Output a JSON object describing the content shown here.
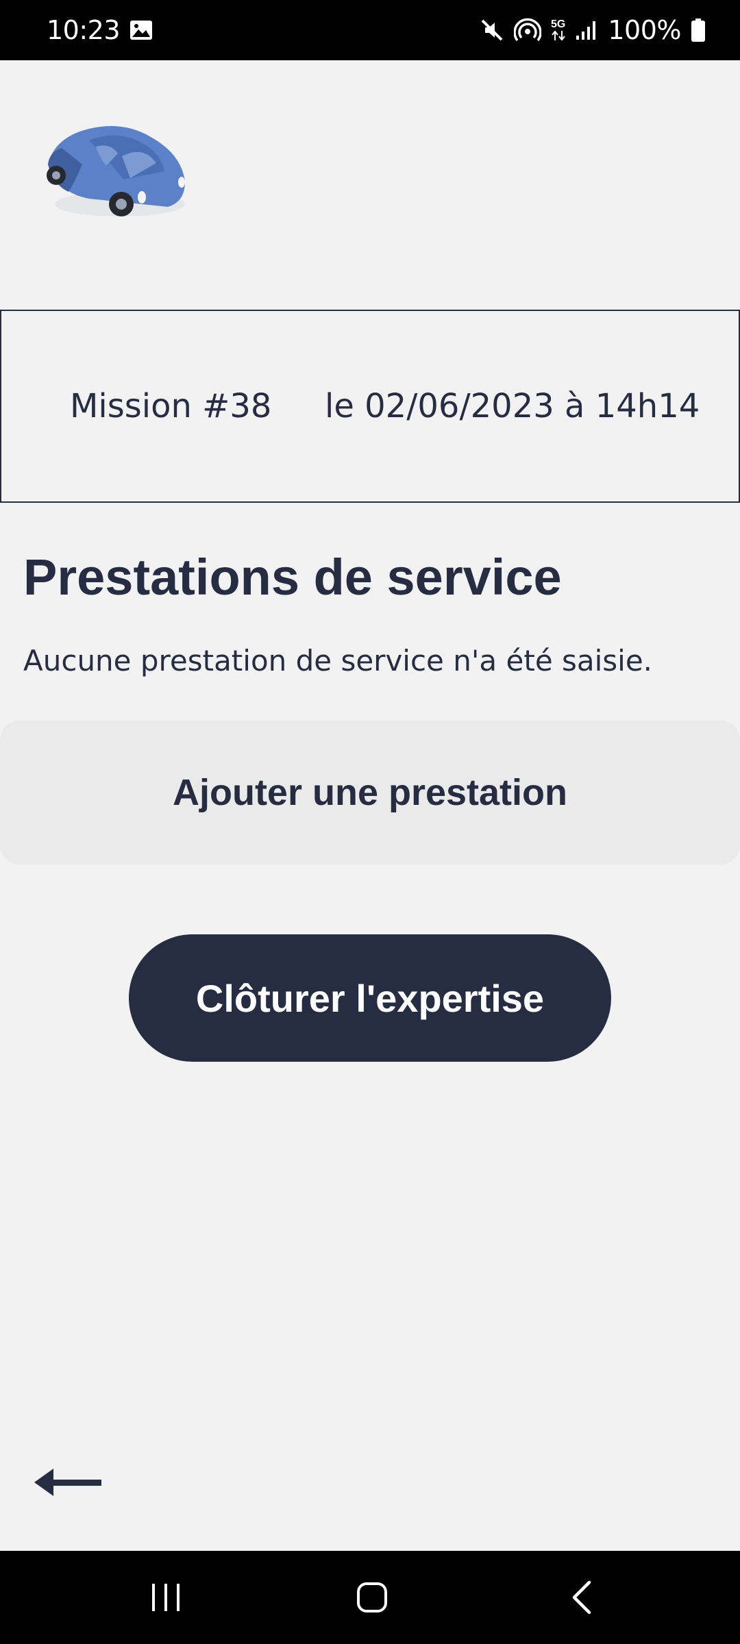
{
  "status_bar": {
    "time": "10:23",
    "network": "5G",
    "battery": "100%",
    "icons": [
      "image-icon",
      "mute-icon",
      "hotspot-icon",
      "signal-icon",
      "battery-icon"
    ]
  },
  "header": {
    "logo_icon": "car-icon"
  },
  "mission": {
    "number": "Mission #38",
    "date": "le 02/06/2023 à 14h14"
  },
  "main": {
    "title": "Prestations de service",
    "empty_message": "Aucune prestation de service n'a été saisie.",
    "add_label": "Ajouter une prestation",
    "close_label": "Clôturer l'expertise"
  },
  "navigation": {
    "back_icon": "arrow-left-icon",
    "system_buttons": [
      "recent-apps-icon",
      "home-icon",
      "back-icon"
    ]
  },
  "colors": {
    "primary": "#262c42",
    "background": "#f2f2f2",
    "secondary_button": "#eaeaea",
    "logo_blue": "#5b82c9"
  }
}
